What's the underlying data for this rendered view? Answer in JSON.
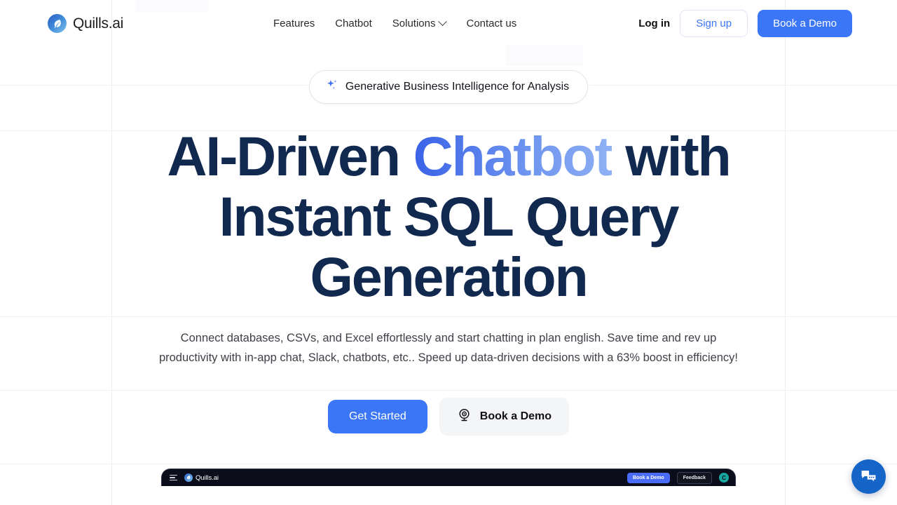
{
  "brand": {
    "name": "Quills.ai",
    "logo_icon": "quill-feather-icon",
    "logo_gradient_from": "#2a5fc4",
    "logo_gradient_to": "#7dc3ec"
  },
  "header": {
    "nav": [
      {
        "label": "Features",
        "has_dropdown": false
      },
      {
        "label": "Chatbot",
        "has_dropdown": false
      },
      {
        "label": "Solutions",
        "has_dropdown": true
      },
      {
        "label": "Contact us",
        "has_dropdown": false
      }
    ],
    "login_label": "Log in",
    "signup_label": "Sign up",
    "book_demo_label": "Book a Demo"
  },
  "hero": {
    "badge": {
      "icon": "sparkle-icon",
      "text": "Generative Business Intelligence for Analysis"
    },
    "headline": {
      "before": "AI-Driven ",
      "highlight": "Chatbot",
      "after": " with Instant SQL Query Generation",
      "highlight_gradient_from": "#3a62e7",
      "highlight_gradient_to": "#8fb0f4",
      "color": "#11294f"
    },
    "subhead": "Connect databases, CSVs, and Excel effortlessly and start chatting in plan english. Save time and rev up productivity with in-app chat, Slack, chatbots, etc.. Speed up data-driven decisions with a 63% boost in efficiency!",
    "primary_cta": "Get Started",
    "secondary_cta": "Book a Demo",
    "secondary_cta_icon": "webcam-icon"
  },
  "app_preview": {
    "menu_icon": "hamburger-menu-icon",
    "brand_name": "Quills.ai",
    "book_demo_label": "Book a Demo",
    "feedback_label": "Feedback",
    "avatar_initial": "C",
    "avatar_color": "#17a7a0"
  },
  "chat_widget": {
    "icon": "chat-bubbles-icon",
    "color": "#1565c8"
  },
  "theme": {
    "accent_blue": "#3b76f6",
    "navy": "#11294f",
    "grid_line": "#eceef2"
  }
}
